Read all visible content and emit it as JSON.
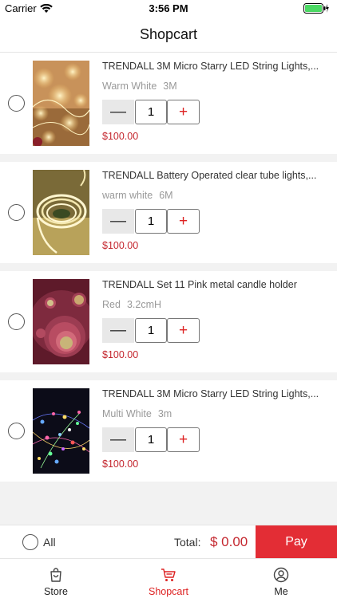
{
  "status_bar": {
    "carrier": "Carrier",
    "time": "3:56 PM"
  },
  "nav": {
    "title": "Shopcart"
  },
  "items": [
    {
      "name": "TRENDALL  3M Micro Starry LED String Lights,...",
      "spec_color": "Warm White",
      "spec_size": "3M",
      "quantity": "1",
      "price": "$100.00",
      "image_icon": "fairy-lights-warm"
    },
    {
      "name": "TRENDALL Battery Operated clear tube lights,...",
      "spec_color": "warm white",
      "spec_size": "6M",
      "quantity": "1",
      "price": "$100.00",
      "image_icon": "rope-lights-coil"
    },
    {
      "name": "TRENDALL  Set 11 Pink metal candle holder",
      "spec_color": "Red",
      "spec_size": "3.2cmH",
      "quantity": "1",
      "price": "$100.00",
      "image_icon": "pink-candle-holders"
    },
    {
      "name": "TRENDALL  3M Micro Starry LED String Lights,...",
      "spec_color": "Multi White",
      "spec_size": "3m",
      "quantity": "1",
      "price": "$100.00",
      "image_icon": "fairy-lights-multicolor"
    }
  ],
  "stepper": {
    "minus": "—",
    "plus": "+"
  },
  "footer": {
    "all_label": "All",
    "total_label": "Total:",
    "total_value": "$ 0.00",
    "pay_label": "Pay"
  },
  "tabs": [
    {
      "label": "Store",
      "icon": "bag-icon"
    },
    {
      "label": "Shopcart",
      "icon": "cart-icon"
    },
    {
      "label": "Me",
      "icon": "user-icon"
    }
  ],
  "colors": {
    "accent": "#e32d35",
    "price": "#c4262e"
  }
}
